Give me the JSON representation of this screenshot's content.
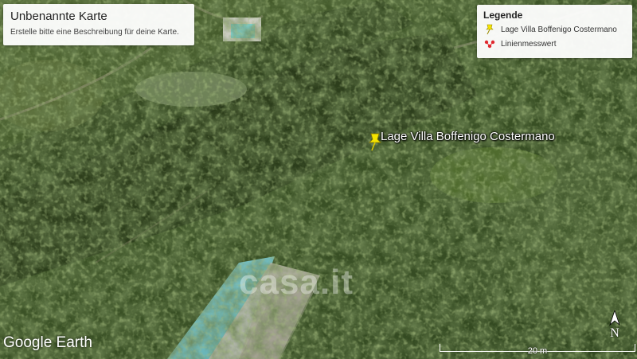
{
  "map": {
    "info_card": {
      "title": "Unbenannte Karte",
      "description": "Erstelle bitte eine Beschreibung für deine Karte."
    },
    "legend": {
      "title": "Legende",
      "items": [
        {
          "label": "Lage Villa Boffenigo Costermano",
          "icon": "yellow-pushpin-icon",
          "color": "#f5e400"
        },
        {
          "label": "Linienmesswert",
          "icon": "line-measure-icon",
          "color": "#e0282e"
        }
      ]
    },
    "place_label": "Lage Villa Boffenigo Costermano",
    "watermark": "casa.it",
    "brand": "Google Earth",
    "scale": "20 m",
    "north": "N"
  }
}
